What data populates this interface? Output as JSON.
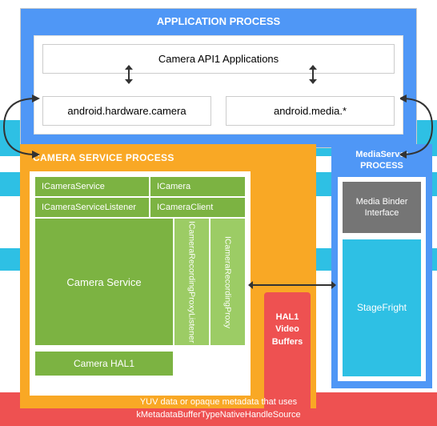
{
  "app_process": {
    "header": "APPLICATION PROCESS",
    "api_box": "Camera API1 Applications",
    "hw_camera": "android.hardware.camera",
    "media": "android.media.*"
  },
  "csp": {
    "header": "CAMERA SERVICE PROCESS",
    "icamera_service": "ICameraService",
    "icamera": "ICamera",
    "icamera_service_listener": "ICameraServiceListener",
    "icamera_client": "ICameraClient",
    "camera_service": "Camera Service",
    "proxy_listener": "ICameraRecordingProxyListener",
    "proxy": "ICameraRecordingProxy",
    "camera_hal": "Camera HAL1"
  },
  "msp": {
    "header_l1": "MediaServer",
    "header_l2": "PROCESS",
    "mbi": "Media Binder Interface",
    "stagefright": "StageFright"
  },
  "hal_buffers": {
    "l1": "HAL1",
    "l2": "Video",
    "l3": "Buffers"
  },
  "footer": {
    "l1": "YUV data or opaque metadata that uses",
    "l2": "kMetadataBufferTypeNativeHandleSource"
  }
}
